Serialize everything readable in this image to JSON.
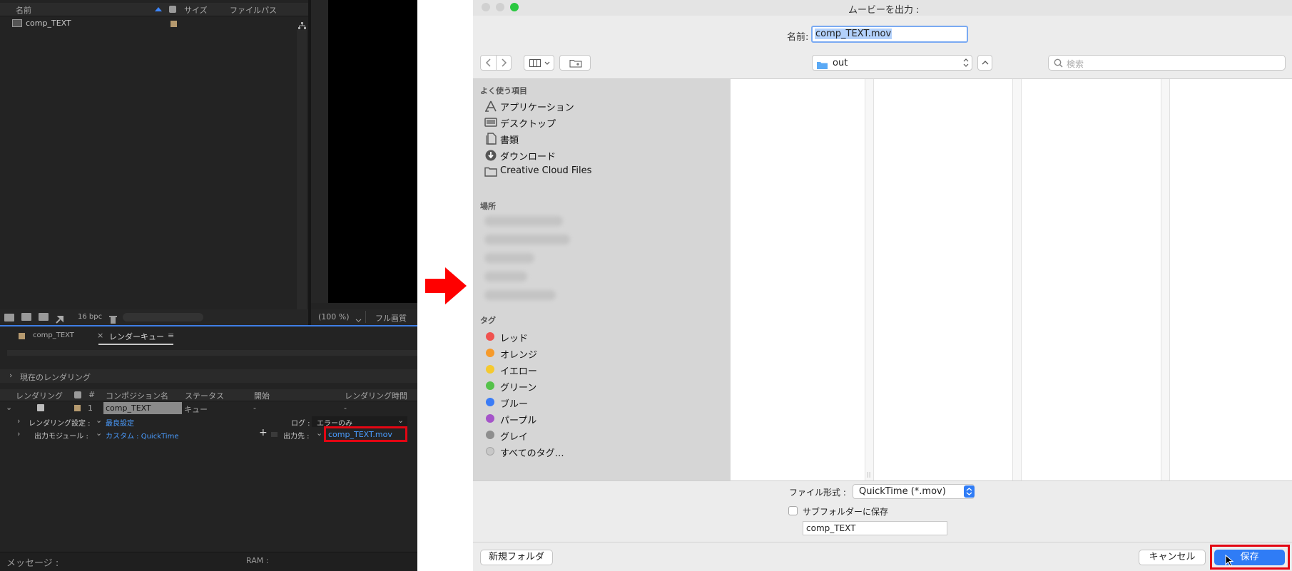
{
  "ae": {
    "project_headers": {
      "name": "名前",
      "size": "サイズ",
      "filepath": "ファイルパス"
    },
    "project_item": "comp_TEXT",
    "bpc": "16 bpc",
    "zoom": "(100 %)",
    "quality": "フル画質",
    "tabs": [
      {
        "label": "comp_TEXT"
      },
      {
        "label": "レンダーキュー"
      }
    ],
    "current_render": "現在のレンダリング",
    "queue_headers": {
      "render": "レンダリング",
      "num": "#",
      "comp_name": "コンポジション名",
      "status": "ステータス",
      "start": "開始",
      "render_time": "レンダリング時間"
    },
    "queue_row": {
      "num": "1",
      "comp": "comp_TEXT",
      "status": "キュー",
      "start": "-",
      "time": "-"
    },
    "render_settings_label": "レンダリング設定 :",
    "render_settings_value": "最良設定",
    "log_label": "ログ :",
    "log_value": "エラーのみ",
    "output_module_label": "出力モジュール :",
    "output_module_value": "カスタム : QuickTime",
    "output_to_label": "出力先 :",
    "output_to_value": "comp_TEXT.mov",
    "message_label": "メッセージ :",
    "ram_label": "RAM :"
  },
  "dialog": {
    "title": "ムービーを出力 :",
    "name_label": "名前:",
    "name_value": "comp_TEXT.mov",
    "location": "out",
    "search_placeholder": "検索",
    "favorites_header": "よく使う項目",
    "favorites": [
      {
        "label": "アプリケーション",
        "icon": "applications-icon"
      },
      {
        "label": "デスクトップ",
        "icon": "desktop-icon"
      },
      {
        "label": "書類",
        "icon": "documents-icon"
      },
      {
        "label": "ダウンロード",
        "icon": "downloads-icon"
      },
      {
        "label": "Creative Cloud Files",
        "icon": "folder-icon"
      }
    ],
    "places_header": "場所",
    "tags_header": "タグ",
    "tags": [
      {
        "label": "レッド",
        "color": "#f0524f"
      },
      {
        "label": "オレンジ",
        "color": "#f69a2a"
      },
      {
        "label": "イエロー",
        "color": "#f5c92e"
      },
      {
        "label": "グリーン",
        "color": "#55c24a"
      },
      {
        "label": "ブルー",
        "color": "#3b7cf6"
      },
      {
        "label": "パープル",
        "color": "#a554c9"
      },
      {
        "label": "グレイ",
        "color": "#8e8e8e"
      },
      {
        "label": "すべてのタグ…",
        "color": "#c8c8c8"
      }
    ],
    "format_label": "ファイル形式 :",
    "format_value": "QuickTime (*.mov)",
    "subfolder_label": "サブフォルダーに保存",
    "subfolder_value": "comp_TEXT",
    "new_folder": "新規フォルダ",
    "cancel": "キャンセル",
    "save": "保存"
  },
  "colors": {
    "accent": "#2f7cf6",
    "highlight": "#e30613",
    "ae_link": "#4a9cff"
  }
}
